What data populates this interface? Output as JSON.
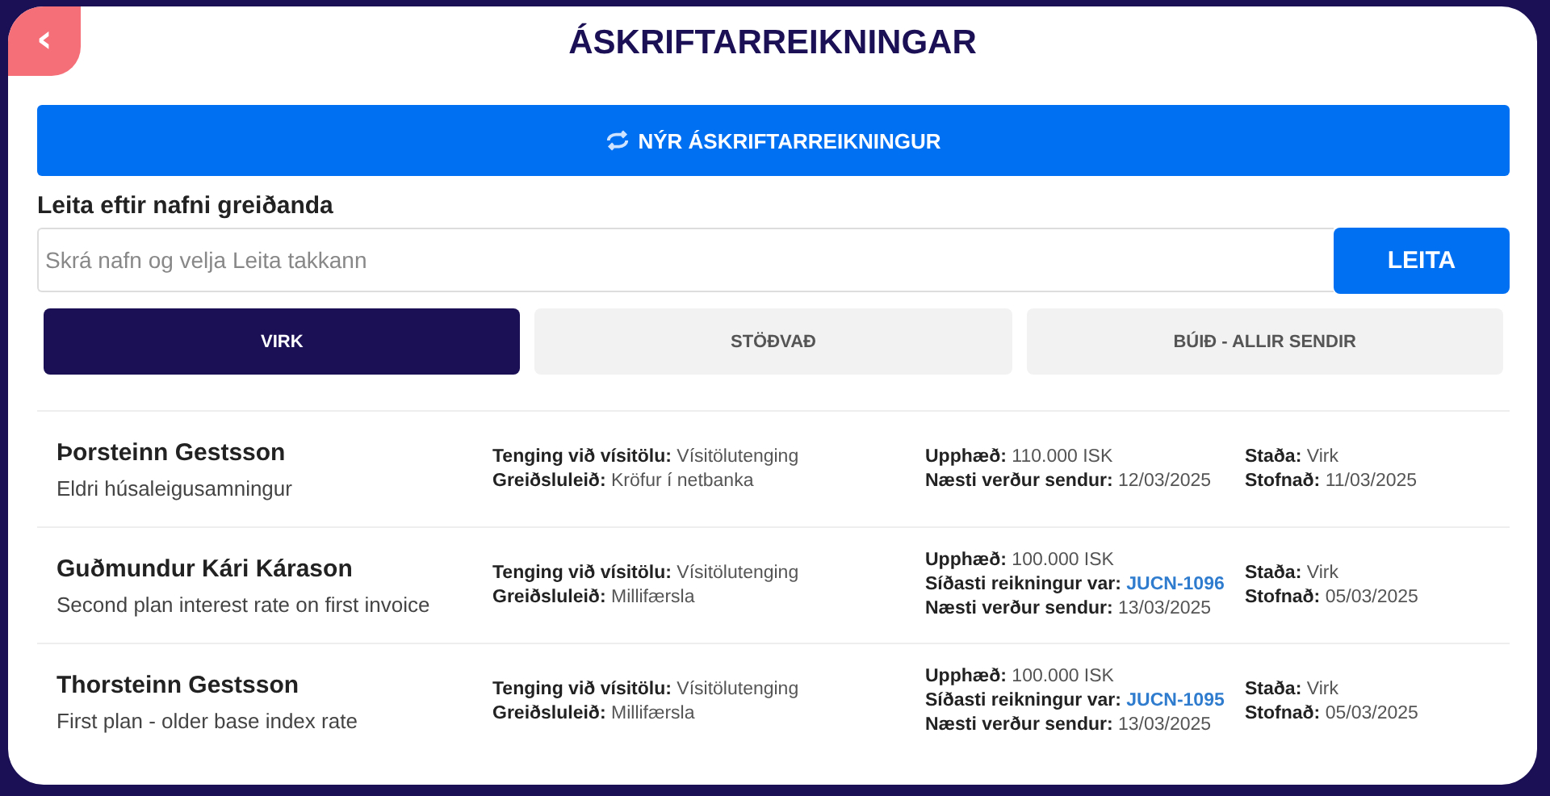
{
  "back_button": {
    "label": "‹"
  },
  "title": "ÁSKRIFTARREIKNINGAR",
  "new_button": {
    "label": "NÝR ÁSKRIFTARREIKNINGUR"
  },
  "search": {
    "label": "Leita eftir nafni greiðanda",
    "placeholder": "Skrá nafn og velja Leita takkann",
    "button": "LEITA"
  },
  "tabs": [
    {
      "label": "VIRK",
      "selected": true
    },
    {
      "label": "STÖÐVAÐ",
      "selected": false
    },
    {
      "label": "BÚIÐ - ALLIR SENDIR",
      "selected": false
    }
  ],
  "rows": [
    {
      "name": "Þorsteinn Gestsson",
      "description": "Eldri húsaleigusamningur",
      "columns": [
        [
          {
            "label": "Tenging við vísitölu:",
            "value": "Vísitölutenging",
            "kind": "text"
          },
          {
            "label": "Greiðsluleið:",
            "value": "Kröfur í netbanka",
            "kind": "text"
          }
        ],
        [
          {
            "label": "Upphæð:",
            "value": "110.000 ISK",
            "kind": "text"
          },
          {
            "label": "Næsti verður sendur:",
            "value": "12/03/2025",
            "kind": "text"
          }
        ],
        [
          {
            "label": "Staða:",
            "value": "Virk",
            "kind": "text"
          },
          {
            "label": "Stofnað:",
            "value": "11/03/2025",
            "kind": "text"
          }
        ]
      ]
    },
    {
      "name": "Guðmundur Kári Kárason",
      "description": "Second plan interest rate on first invoice",
      "columns": [
        [
          {
            "label": "Tenging við vísitölu:",
            "value": "Vísitölutenging",
            "kind": "text"
          },
          {
            "label": "Greiðsluleið:",
            "value": "Millifærsla",
            "kind": "text"
          }
        ],
        [
          {
            "label": "Upphæð:",
            "value": "100.000 ISK",
            "kind": "text"
          },
          {
            "label": "Síðasti reikningur var:",
            "value": "JUCN-1096",
            "kind": "link"
          },
          {
            "label": "Næsti verður sendur:",
            "value": "13/03/2025",
            "kind": "text"
          }
        ],
        [
          {
            "label": "Staða:",
            "value": "Virk",
            "kind": "text"
          },
          {
            "label": "Stofnað:",
            "value": "05/03/2025",
            "kind": "text"
          }
        ]
      ]
    },
    {
      "name": "Thorsteinn Gestsson",
      "description": "First plan - older base index rate",
      "columns": [
        [
          {
            "label": "Tenging við vísitölu:",
            "value": "Vísitölutenging",
            "kind": "text"
          },
          {
            "label": "Greiðsluleið:",
            "value": "Millifærsla",
            "kind": "text"
          }
        ],
        [
          {
            "label": "Upphæð:",
            "value": "100.000 ISK",
            "kind": "text"
          },
          {
            "label": "Síðasti reikningur var:",
            "value": "JUCN-1095",
            "kind": "link"
          },
          {
            "label": "Næsti verður sendur:",
            "value": "13/03/2025",
            "kind": "text"
          }
        ],
        [
          {
            "label": "Staða:",
            "value": "Virk",
            "kind": "text"
          },
          {
            "label": "Stofnað:",
            "value": "05/03/2025",
            "kind": "text"
          }
        ]
      ]
    }
  ]
}
